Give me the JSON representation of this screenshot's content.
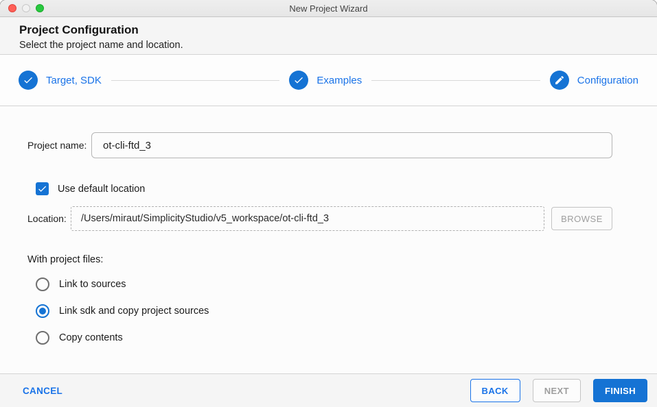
{
  "window": {
    "title": "New Project Wizard"
  },
  "header": {
    "title": "Project Configuration",
    "subtitle": "Select the project name and location."
  },
  "stepper": {
    "steps": [
      {
        "label": "Target, SDK",
        "icon": "check-icon",
        "state": "complete"
      },
      {
        "label": "Examples",
        "icon": "check-icon",
        "state": "complete"
      },
      {
        "label": "Configuration",
        "icon": "pencil-icon",
        "state": "current"
      }
    ]
  },
  "form": {
    "project_name": {
      "label": "Project name:",
      "value": "ot-cli-ftd_3"
    },
    "use_default_location": {
      "label": "Use default location",
      "checked": true
    },
    "location": {
      "label": "Location:",
      "value": "/Users/miraut/SimplicityStudio/v5_workspace/ot-cli-ftd_3",
      "browse_label": "BROWSE",
      "browse_enabled": false
    },
    "with_project_files": {
      "label": "With project files:",
      "options": [
        {
          "label": "Link to sources",
          "selected": false
        },
        {
          "label": "Link sdk and copy project sources",
          "selected": true
        },
        {
          "label": "Copy contents",
          "selected": false
        }
      ]
    }
  },
  "footer": {
    "cancel_label": "CANCEL",
    "back_label": "BACK",
    "next_label": "NEXT",
    "next_enabled": false,
    "finish_label": "FINISH"
  },
  "icons": {
    "check": "✓",
    "pencil": "✎"
  },
  "colors": {
    "accent_fill": "#1573d4",
    "accent_text": "#1a73e8",
    "disabled_text": "#9e9e9e",
    "header_bg": "#f5f5f5",
    "border": "#d4d4d4",
    "traffic_close": "#ff5f57",
    "traffic_zoom": "#28c840"
  }
}
